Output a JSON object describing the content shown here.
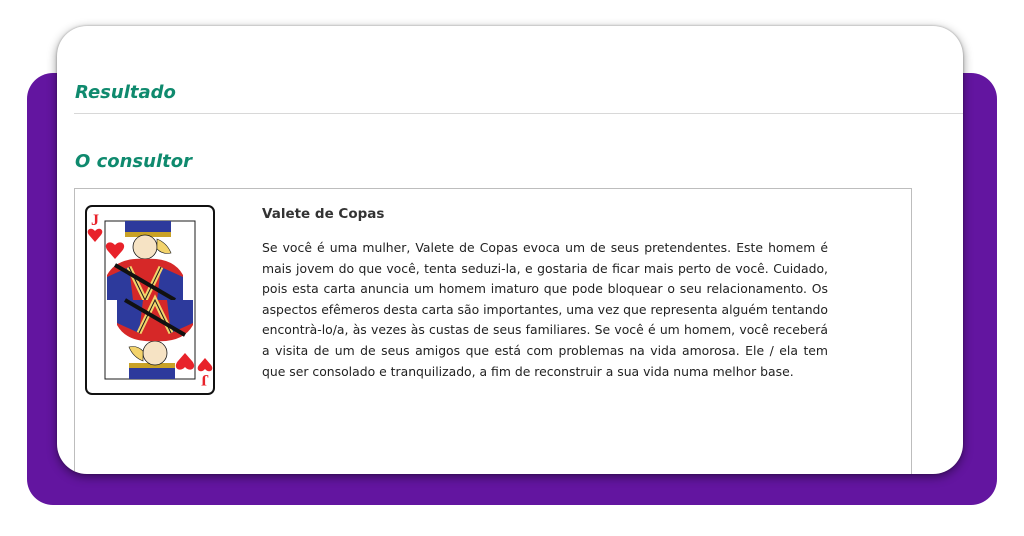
{
  "sections": {
    "result_title": "Resultado",
    "consultant_title": "O consultor"
  },
  "card": {
    "name": "Valete de Copas",
    "rank_glyph": "J",
    "image_icon": "jack-of-hearts-card-icon",
    "description": "Se você é uma mulher, Valete de Copas evoca um de seus pretendentes. Este homem é mais jovem do que você, tenta seduzi-la, e gostaria de ficar mais perto de você. Cuidado, pois esta carta anuncia um homem imaturo que pode bloquear o seu relacionamento. Os aspectos efêmeros desta carta são importantes, uma vez que representa alguém tentando encontrà-lo/a, às vezes às custas de seus familiares. Se você é um homem, você receberá a visita de um de seus amigos que está com problemas na vida amorosa. Ele / ela tem que ser consolado e tranquilizado, a fim de reconstruir a sua vida numa melhor base."
  },
  "colors": {
    "title_green": "#0f8a6e",
    "background_purple": "#6315a0",
    "heart_red": "#e8222a"
  }
}
